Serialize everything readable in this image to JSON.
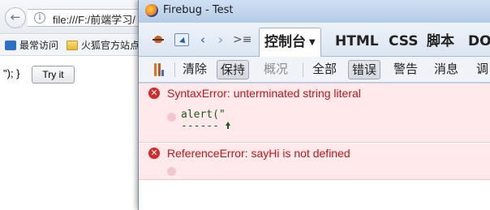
{
  "background_browser": {
    "url": "file:///F:/前端学习/",
    "bookmarks": [
      {
        "label": "最常访问",
        "icon": "bookmark-icon"
      },
      {
        "label": "火狐官方站点",
        "icon": "folder-icon"
      }
    ],
    "page_text": "\"); }",
    "try_button_label": "Try it"
  },
  "firebug": {
    "window_title": "Firebug - Test",
    "tabs": [
      {
        "label": "控制台",
        "active": true
      },
      {
        "label": "HTML"
      },
      {
        "label": "CSS"
      },
      {
        "label": "脚本"
      },
      {
        "label": "DO"
      }
    ],
    "filters": [
      {
        "label": "清除"
      },
      {
        "label": "保持",
        "pressed": true
      },
      {
        "label": "概况",
        "disabled": true
      },
      {
        "label": "全部"
      },
      {
        "label": "错误",
        "pressed": true
      },
      {
        "label": "警告"
      },
      {
        "label": "消息"
      },
      {
        "label": "调"
      }
    ],
    "errors": [
      {
        "message": "SyntaxError: unterminated string literal",
        "source_line": "alert(\"",
        "marker_line": "------"
      },
      {
        "message": "ReferenceError: sayHi is not defined"
      }
    ],
    "colors": {
      "error_text": "#c2151a",
      "error_row_bg": "#ffe9ea",
      "source_code": "#1d5a1d",
      "toolbar_accent": "#4a78b8"
    }
  }
}
